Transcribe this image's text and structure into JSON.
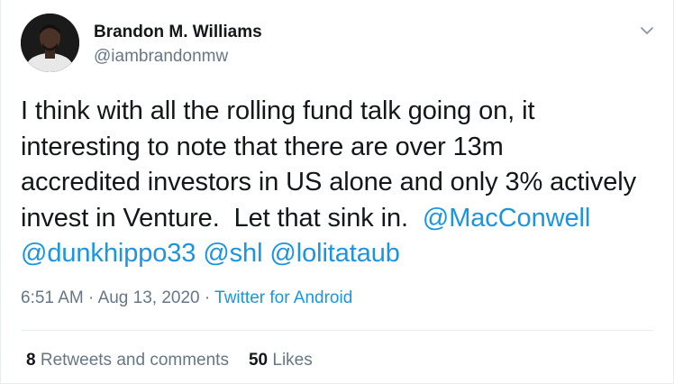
{
  "user": {
    "name": "Brandon M. Williams",
    "handle": "@iambrandonmw"
  },
  "tweet": {
    "text_line1": "I think with all the rolling fund talk going on, it",
    "text_line2": "interesting to note that there are over 13m",
    "text_line3": "accredited investors in US alone and only 3% actively",
    "text_line4": "invest in Venture.  Let that sink in. ",
    "mentions": [
      "@MacConwell",
      "@dunkhippo33",
      "@shl",
      "@lolitataub"
    ]
  },
  "meta": {
    "time": "6:51 AM",
    "separator": "·",
    "date": "Aug 13, 2020",
    "source": "Twitter for Android"
  },
  "stats": {
    "retweets_count": "8",
    "retweets_label": "Retweets and comments",
    "likes_count": "50",
    "likes_label": "Likes"
  },
  "colors": {
    "link": "#1b95e0",
    "secondary_text": "#657786",
    "primary_text": "#14171a"
  },
  "icons": {
    "menu": "chevron-down-icon"
  }
}
